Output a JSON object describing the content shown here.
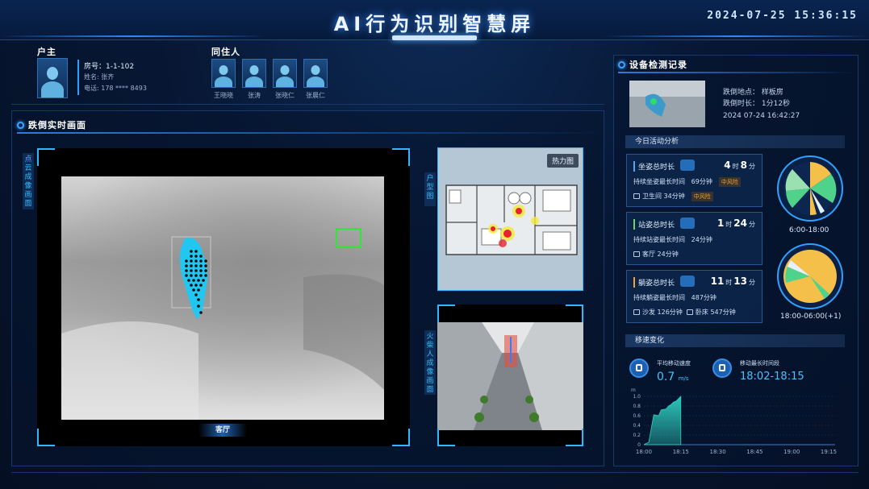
{
  "header": {
    "title": "AI行为识别智慧屏",
    "datetime": "2024-07-25 15:36:15"
  },
  "household": {
    "owner_section": "户主",
    "room_label": "房号：1-1-102",
    "name_label": "姓名: 张齐",
    "phone_label": "电话: 178 **** 8493",
    "cohabitant_section": "同住人",
    "cohabitants": [
      "王晓晓",
      "张涛",
      "张晓仁",
      "张晨仁"
    ]
  },
  "fall_section": {
    "title": "跌倒实时画面",
    "point_cloud_label": "点云成像画面",
    "floorplan_label": "户型图",
    "heatmap_button": "热力图",
    "stick_label": "火柴人成像画面",
    "room_tag": "客厅"
  },
  "device_log": {
    "title": "设备检测记录",
    "location": "跌倒地点：  样板房",
    "duration": "跌倒时长：  1分12秒",
    "timestamp": "2024 07-24 16:42:27"
  },
  "activity": {
    "title": "今日活动分析",
    "cards": [
      {
        "label": "坐姿总时长",
        "h": "4",
        "m": "8",
        "unit_h": "时",
        "unit_m": "分",
        "accent": "#4aa8ff",
        "l2": "持续坐姿最长时间",
        "l2v": "69分钟",
        "badge1": "中风险",
        "l3": "卫生间 34分钟",
        "badge2": "中风险",
        "icon": "sitting-icon"
      },
      {
        "label": "站姿总时长",
        "h": "1",
        "m": "24",
        "unit_h": "时",
        "unit_m": "分",
        "accent": "#6dd36a",
        "l2": "持续站姿最长时间",
        "l2v": "24分钟",
        "l3": "客厅 24分钟",
        "icon": "standing-icon"
      },
      {
        "label": "躺姿总时长",
        "h": "11",
        "m": "13",
        "unit_h": "时",
        "unit_m": "分",
        "accent": "#f0a23a",
        "l2": "持续躺姿最长时间",
        "l2v": "487分钟",
        "l3a": "沙发 126分钟",
        "l3b": "卧床 547分钟",
        "icon": "lying-icon"
      }
    ],
    "clock1_label": "6:00-18:00",
    "clock2_label": "18:00-06:00(+1)"
  },
  "movement": {
    "title": "移速变化",
    "avg_label": "平均移动速度",
    "avg_value": "0.7",
    "avg_unit": "m/s",
    "peak_label": "移动最长时间段",
    "peak_value": "18:02-18:15"
  },
  "chart_data": {
    "type": "area",
    "title": "",
    "ylabel": "m",
    "yticks": [
      "1.0",
      "0.8",
      "0.6",
      "0.4",
      "0.2",
      "0"
    ],
    "ylim": [
      0,
      1.0
    ],
    "x_ticks": [
      "18:00",
      "18:15",
      "18:30",
      "18:45",
      "19:00",
      "19:15"
    ],
    "series": [
      {
        "x": [
          "18:00",
          "18:02",
          "18:04",
          "18:06",
          "18:07",
          "18:09",
          "18:10",
          "18:11",
          "18:12",
          "18:13",
          "18:14",
          "18:15",
          "18:15"
        ],
        "values": [
          0,
          0.05,
          0.62,
          0.6,
          0.72,
          0.74,
          0.8,
          0.83,
          0.88,
          0.9,
          0.95,
          1.0,
          0
        ]
      }
    ],
    "color": "#2fd0c0"
  }
}
